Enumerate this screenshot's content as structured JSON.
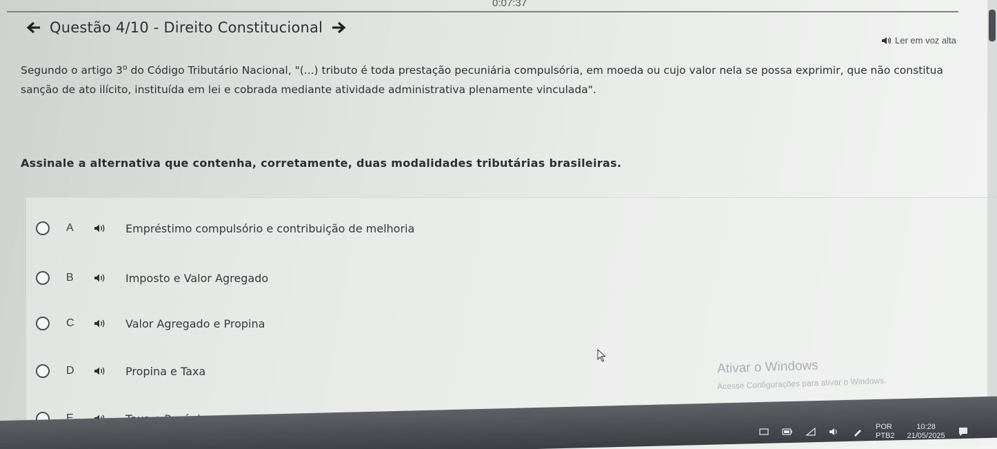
{
  "timer": "0:07:37",
  "header": {
    "title": "Questão 4/10 - Direito Constitucional",
    "back_icon": "arrow-left-icon",
    "next_icon": "arrow-right-icon"
  },
  "read_aloud": {
    "label": "Ler em voz alta",
    "icon": "speaker-icon"
  },
  "question": {
    "text_before_sup": "Segundo o artigo 3",
    "sup": "o",
    "text_after_sup": " do Código Tributário Nacional, \"(...) tributo é toda prestação pecuniária compulsória, em moeda ou cujo valor nela se possa exprimir, que não constitua sanção de ato ilícito, instituída em lei e cobrada mediante atividade administrativa plenamente vinculada\"."
  },
  "instruction": "Assinale a alternativa que contenha, corretamente, duas modalidades tributárias brasileiras.",
  "alternatives": [
    {
      "letter": "A",
      "text": "Empréstimo compulsório e contribuição de melhoria"
    },
    {
      "letter": "B",
      "text": "Imposto e Valor Agregado"
    },
    {
      "letter": "C",
      "text": "Valor Agregado e Propina"
    },
    {
      "letter": "D",
      "text": "Propina e Taxa"
    },
    {
      "letter": "E",
      "text": "Taxa e Pecúnia"
    }
  ],
  "watermark": {
    "title": "Ativar o Windows",
    "subtitle": "Acesse Configurações para ativar o Windows."
  },
  "taskbar": {
    "language": "POR",
    "keyboard": "PTB2",
    "time": "10:28",
    "date": "21/05/2025"
  }
}
